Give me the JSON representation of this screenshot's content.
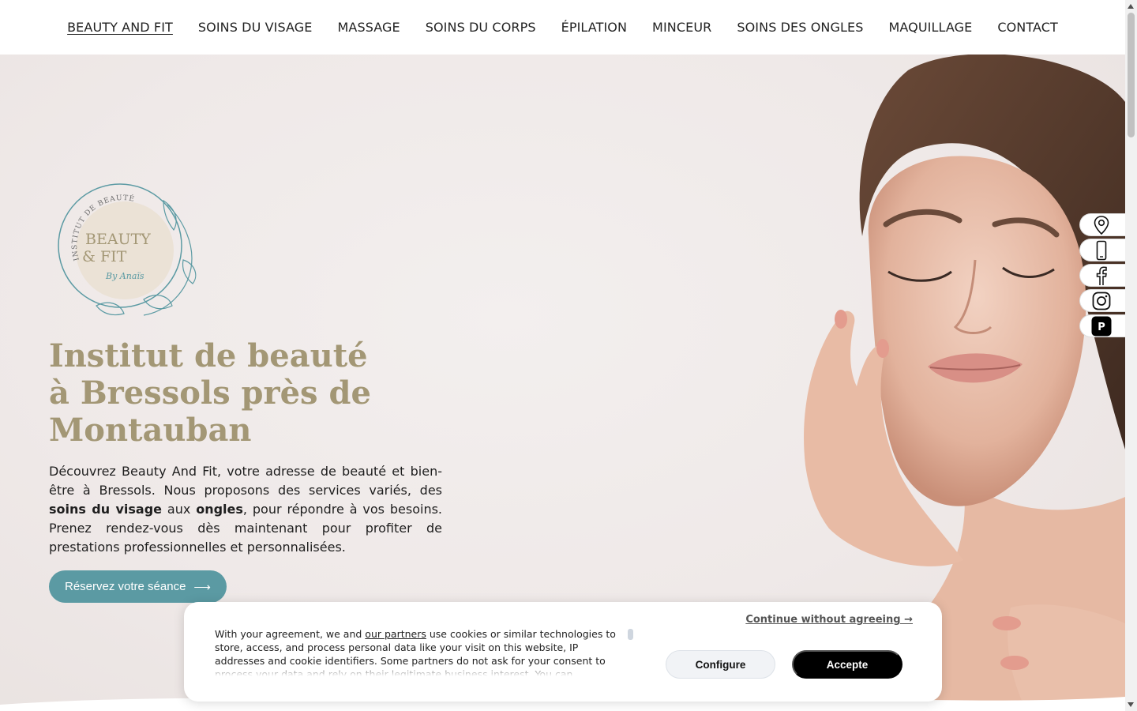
{
  "nav": {
    "items": [
      {
        "label": "BEAUTY AND FIT"
      },
      {
        "label": "SOINS DU VISAGE"
      },
      {
        "label": "MASSAGE"
      },
      {
        "label": "SOINS DU CORPS"
      },
      {
        "label": "ÉPILATION"
      },
      {
        "label": "MINCEUR"
      },
      {
        "label": "SOINS DES ONGLES"
      },
      {
        "label": "MAQUILLAGE"
      },
      {
        "label": "CONTACT"
      }
    ]
  },
  "logo": {
    "arc_text": "INSTITUT DE BEAUTÉ",
    "line1": "BEAUTY",
    "line2": "& FIT",
    "signature": "By Anaïs"
  },
  "hero": {
    "title": "Institut de beauté à Bressols près de Montauban",
    "text_1": "Découvrez Beauty And Fit, votre adresse de beauté et bien-être à Bressols. Nous proposons des services variés, des ",
    "text_bold_1": "soins du visage",
    "text_2": " aux ",
    "text_bold_2": "ongles",
    "text_3": ", pour répondre à vos besoins. Prenez rendez-vous dès maintenant pour profiter de prestations professionnelles et personnalisées.",
    "cta_label": "Réservez votre séance",
    "cta_arrow": "⟶"
  },
  "sidebar": {
    "icons": [
      "location-pin-icon",
      "phone-icon",
      "facebook-icon",
      "instagram-icon",
      "planity-icon"
    ],
    "planity_letter": "P"
  },
  "cookie": {
    "text_before_link": "With your agreement, we and ",
    "link": "our partners",
    "text_after_link": " use cookies or similar technologies to store, access, and process personal data like your visit on this website, IP addresses and cookie identifiers. Some partners do not ask for your consent to process your data and rely on their legitimate business interest. You can",
    "continue_label": "Continue without agreeing →",
    "configure_label": "Configure",
    "accept_label": "Accepte"
  },
  "colors": {
    "accent": "#5b9aa3",
    "title": "#a39775",
    "hero_bg": "#efe9e8"
  }
}
